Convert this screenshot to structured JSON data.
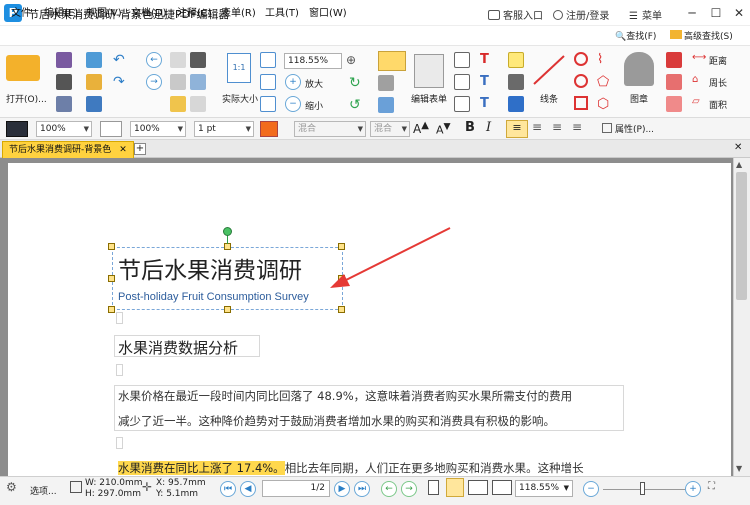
{
  "window": {
    "title": "节后水果消费调研-背景色迅捷PDF编辑器",
    "logo_letter": "P",
    "support": "客服入口",
    "account": "注册/登录",
    "menu": "菜单"
  },
  "menubar": [
    "文件",
    "编辑(E)",
    "视图(V)",
    "文档(D)",
    "注释(C)",
    "表单(R)",
    "工具(T)",
    "窗口(W)"
  ],
  "ribbon": {
    "open_label": "打开(O)...",
    "actual_size_label": "实际大小",
    "zoom": "118.55%",
    "zoom_in": "放大",
    "zoom_out": "缩小",
    "edit_form_label": "编辑表单",
    "line_label": "线条",
    "stamp_label": "图章",
    "distance_label": "距离",
    "perimeter_label": "周长",
    "area_label": "面积",
    "find_label": "查找(F)",
    "advanced_find_label": "高级查找(S)"
  },
  "propbar": {
    "fill_opacity": "100%",
    "stroke_opacity": "100%",
    "line_width": "1 pt",
    "blend_mode_1": "混合",
    "blend_mode_2": "混合",
    "properties_label": "属性(P)..."
  },
  "tabs": {
    "active": "节后水果消费调研-背景色"
  },
  "document": {
    "title": "节后水果消费调研",
    "subtitle": "Post-holiday Fruit Consumption Survey",
    "section_heading": "水果消费数据分析",
    "para1_line1": "水果价格在最近一段时间内同比回落了 48.9%，这意味着消费者购买水果所需支付的费用",
    "para1_line2": "减少了近一半。这种降价趋势对于鼓励消费者增加水果的购买和消费具有积极的影响。",
    "para2_highlight": "水果消费在同比上涨了 17.4%。",
    "para2_rest": "相比去年同期，人们正在更多地购买和消费水果。这种增长"
  },
  "status": {
    "select_label": "选项...",
    "width": "W: 210.0mm",
    "height": "H: 297.0mm",
    "x": "X: 95.7mm",
    "y": "Y: 5.1mm",
    "page": "1",
    "page_total": "/2",
    "zoom": "118.55%"
  },
  "colors": {
    "accent": "#1e8fe1",
    "tab_active": "#ffd23f",
    "highlight": "#ffd84d",
    "arrow": "#e53935",
    "selection_handle": "#ffe38a"
  }
}
